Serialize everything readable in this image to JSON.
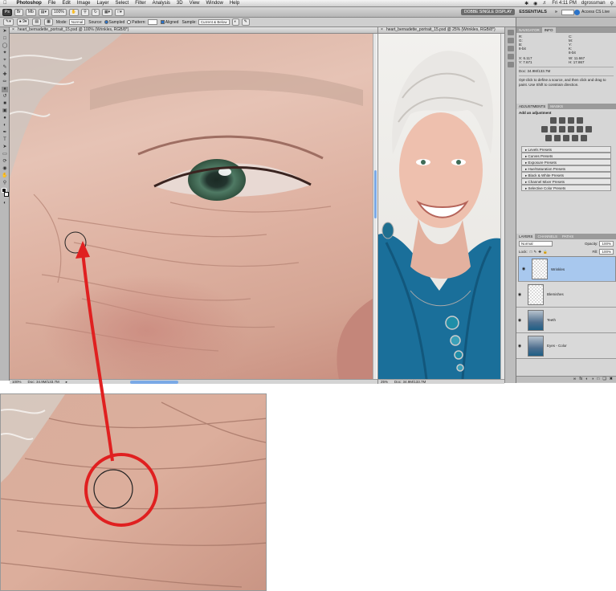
{
  "menubar": {
    "apple": "",
    "app": "Photoshop",
    "items": [
      "File",
      "Edit",
      "Image",
      "Layer",
      "Select",
      "Filter",
      "Analysis",
      "3D",
      "View",
      "Window",
      "Help"
    ],
    "clock": "Fri 4:11 PM",
    "user": "dgrossman"
  },
  "appbar": {
    "zoom": "100%",
    "workspace_button": "DOBBE SINGLE DISPLAY",
    "essentials": "ESSENTIALS",
    "more": "»",
    "cslive": "Access CS Live"
  },
  "options": {
    "mode_label": "Mode:",
    "mode_value": "Normal",
    "source_label": "Source:",
    "sampled": "Sampled",
    "pattern": "Pattern:",
    "aligned": "Aligned",
    "sample_label": "Sample:",
    "sample_value": "Current & Below"
  },
  "doc_left": {
    "tab": "heart_bernadette_portrait_15.psd @ 100% (Wrinkles, RGB/8*)",
    "zoom": "100%",
    "doc": "Doc: 34.9M/133.7M"
  },
  "doc_right": {
    "tab": "heart_bernadette_portrait_15.psd @ 25% (Wrinkles, RGB/8*)",
    "zoom": "25%",
    "doc": "Doc: 34.9M/133.7M"
  },
  "info_panel": {
    "tabs": [
      "NAVIGATOR",
      "INFO"
    ],
    "r_label": "R:",
    "g_label": "G:",
    "b_label": "B:",
    "c_label": "C:",
    "m_label": "M:",
    "y_label": "Y:",
    "k_label": "K:",
    "bit_left": "8-bit",
    "bit_right": "8-bit",
    "x_label": "X:",
    "x_value": "6.117",
    "y2_label": "Y:",
    "y_value": "7.671",
    "w_label": "W:",
    "w_value": "11.667",
    "h_label": "H:",
    "h_value": "17.867",
    "doc": "Doc: 34.9M/133.7M",
    "hint": "Opt-click to define a source, and then click and drag to paint. Use Shift to constrain direction."
  },
  "adjustments": {
    "tabs": [
      "ADJUSTMENTS",
      "MASKS"
    ],
    "title": "Add an adjustment",
    "presets": [
      "Levels Presets",
      "Curves Presets",
      "Exposure Presets",
      "Hue/Saturation Presets",
      "Black & White Presets",
      "Channel Mixer Presets",
      "Selective Color Presets"
    ]
  },
  "layers": {
    "tabs": [
      "LAYERS",
      "CHANNELS",
      "PATHS"
    ],
    "blend": "Normal",
    "opacity_label": "Opacity:",
    "opacity": "100%",
    "lock_label": "Lock:",
    "fill_label": "Fill:",
    "fill": "100%",
    "items": [
      {
        "name": "Wrinkles",
        "selected": true
      },
      {
        "name": "Blemishes",
        "selected": false
      },
      {
        "name": "Teeth",
        "selected": false
      },
      {
        "name": "Eyes - Color",
        "selected": false
      }
    ]
  },
  "colors": {
    "accent": "#2b73c9",
    "callout": "#e02020",
    "selection": "#a8c8ee"
  }
}
